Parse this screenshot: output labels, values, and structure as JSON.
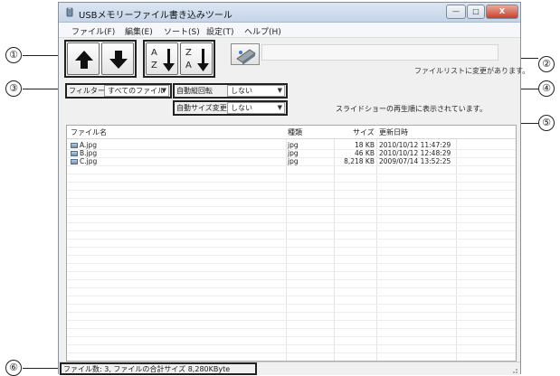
{
  "window": {
    "title": "USBメモリーファイル書き込みツール",
    "controls": {
      "minimize": "—",
      "maximize": "□",
      "close": "X"
    }
  },
  "menu": [
    {
      "label": "ファイル(F)"
    },
    {
      "label": "編集(E)"
    },
    {
      "label": "ソート(S)"
    },
    {
      "label": "設定(T)"
    },
    {
      "label": "ヘルプ(H)"
    }
  ],
  "toolbar": {
    "move_up_icon": "arrow-up-icon",
    "move_down_icon": "arrow-down-icon",
    "sort_az_top": "A",
    "sort_az_bottom": "Z",
    "sort_za_top": "Z",
    "sort_za_bottom": "A",
    "save_icon": "usb-write-icon"
  },
  "status_message": "ファイルリストに変更があります。",
  "filter": {
    "label": "フィルター",
    "value": "すべてのファイル"
  },
  "auto_rotate": {
    "label": "自動縦回転",
    "value": "しない"
  },
  "auto_resize": {
    "label": "自動サイズ変更",
    "value": "しない"
  },
  "slideshow_note": "スライドショーの再生順に表示されています。",
  "file_list": {
    "columns": [
      "ファイル名",
      "種類",
      "サイズ",
      "更新日時"
    ],
    "rows": [
      {
        "name": "A.jpg",
        "type": "jpg",
        "size": "18 KB",
        "modified": "2010/10/12 11:47:29"
      },
      {
        "name": "B.jpg",
        "type": "jpg",
        "size": "46 KB",
        "modified": "2010/10/12 12:48:29"
      },
      {
        "name": "C.jpg",
        "type": "jpg",
        "size": "8,218 KB",
        "modified": "2009/07/14 13:52:25"
      }
    ]
  },
  "statusbar": {
    "text": "ファイル数: 3, ファイルの合計サイズ 8,280KByte"
  },
  "callouts": [
    "①",
    "②",
    "③",
    "④",
    "⑤",
    "⑥"
  ],
  "colors": {
    "frame": "#222222",
    "title_bg": "#c5d5e8",
    "close_button": "#c8412b"
  }
}
